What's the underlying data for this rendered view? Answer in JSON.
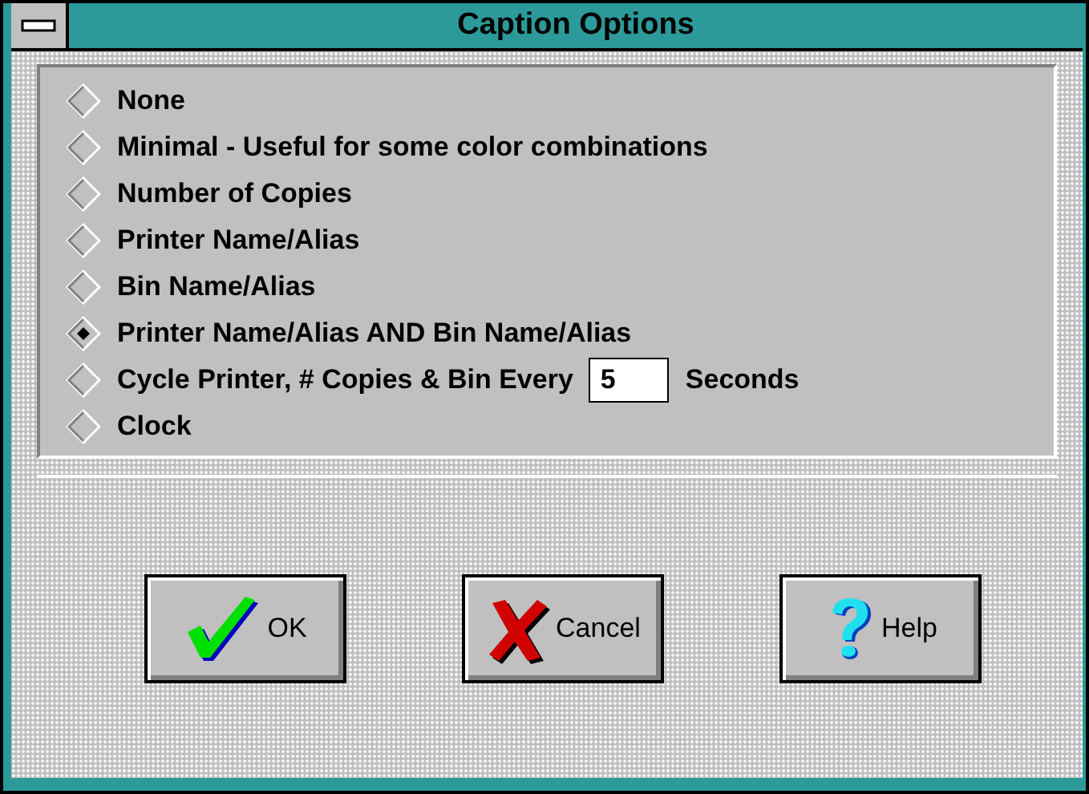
{
  "window": {
    "title": "Caption Options"
  },
  "options": [
    {
      "kind": "plain",
      "label": "None",
      "selected": false
    },
    {
      "kind": "plain",
      "label": "Minimal - Useful for some color combinations",
      "selected": false
    },
    {
      "kind": "plain",
      "label": "Number of Copies",
      "selected": false
    },
    {
      "kind": "plain",
      "label": "Printer Name/Alias",
      "selected": false
    },
    {
      "kind": "plain",
      "label": "Bin Name/Alias",
      "selected": false
    },
    {
      "kind": "plain",
      "label": "Printer Name/Alias AND Bin Name/Alias",
      "selected": true
    },
    {
      "kind": "interval",
      "label": "Cycle Printer, # Copies & Bin Every",
      "value": "5",
      "suffix": "Seconds",
      "selected": false
    },
    {
      "kind": "plain",
      "label": "Clock",
      "selected": false
    }
  ],
  "buttons": [
    {
      "kind": "ok",
      "label": "OK"
    },
    {
      "kind": "cancel",
      "label": "Cancel"
    },
    {
      "kind": "help",
      "label": "Help"
    }
  ]
}
